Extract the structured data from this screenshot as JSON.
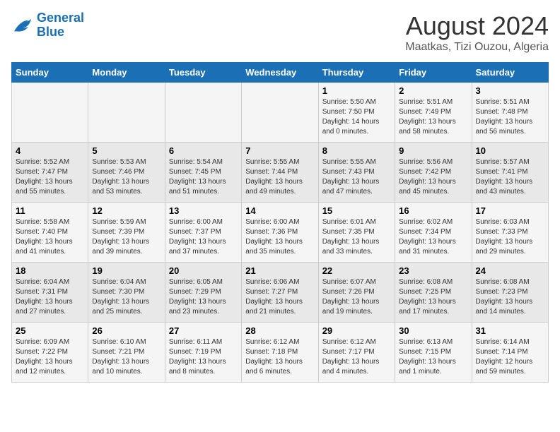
{
  "header": {
    "logo_line1": "General",
    "logo_line2": "Blue",
    "title": "August 2024",
    "subtitle": "Maatkas, Tizi Ouzou, Algeria"
  },
  "calendar": {
    "weekdays": [
      "Sunday",
      "Monday",
      "Tuesday",
      "Wednesday",
      "Thursday",
      "Friday",
      "Saturday"
    ],
    "weeks": [
      [
        {
          "day": "",
          "info": ""
        },
        {
          "day": "",
          "info": ""
        },
        {
          "day": "",
          "info": ""
        },
        {
          "day": "",
          "info": ""
        },
        {
          "day": "1",
          "info": "Sunrise: 5:50 AM\nSunset: 7:50 PM\nDaylight: 14 hours\nand 0 minutes."
        },
        {
          "day": "2",
          "info": "Sunrise: 5:51 AM\nSunset: 7:49 PM\nDaylight: 13 hours\nand 58 minutes."
        },
        {
          "day": "3",
          "info": "Sunrise: 5:51 AM\nSunset: 7:48 PM\nDaylight: 13 hours\nand 56 minutes."
        }
      ],
      [
        {
          "day": "4",
          "info": "Sunrise: 5:52 AM\nSunset: 7:47 PM\nDaylight: 13 hours\nand 55 minutes."
        },
        {
          "day": "5",
          "info": "Sunrise: 5:53 AM\nSunset: 7:46 PM\nDaylight: 13 hours\nand 53 minutes."
        },
        {
          "day": "6",
          "info": "Sunrise: 5:54 AM\nSunset: 7:45 PM\nDaylight: 13 hours\nand 51 minutes."
        },
        {
          "day": "7",
          "info": "Sunrise: 5:55 AM\nSunset: 7:44 PM\nDaylight: 13 hours\nand 49 minutes."
        },
        {
          "day": "8",
          "info": "Sunrise: 5:55 AM\nSunset: 7:43 PM\nDaylight: 13 hours\nand 47 minutes."
        },
        {
          "day": "9",
          "info": "Sunrise: 5:56 AM\nSunset: 7:42 PM\nDaylight: 13 hours\nand 45 minutes."
        },
        {
          "day": "10",
          "info": "Sunrise: 5:57 AM\nSunset: 7:41 PM\nDaylight: 13 hours\nand 43 minutes."
        }
      ],
      [
        {
          "day": "11",
          "info": "Sunrise: 5:58 AM\nSunset: 7:40 PM\nDaylight: 13 hours\nand 41 minutes."
        },
        {
          "day": "12",
          "info": "Sunrise: 5:59 AM\nSunset: 7:39 PM\nDaylight: 13 hours\nand 39 minutes."
        },
        {
          "day": "13",
          "info": "Sunrise: 6:00 AM\nSunset: 7:37 PM\nDaylight: 13 hours\nand 37 minutes."
        },
        {
          "day": "14",
          "info": "Sunrise: 6:00 AM\nSunset: 7:36 PM\nDaylight: 13 hours\nand 35 minutes."
        },
        {
          "day": "15",
          "info": "Sunrise: 6:01 AM\nSunset: 7:35 PM\nDaylight: 13 hours\nand 33 minutes."
        },
        {
          "day": "16",
          "info": "Sunrise: 6:02 AM\nSunset: 7:34 PM\nDaylight: 13 hours\nand 31 minutes."
        },
        {
          "day": "17",
          "info": "Sunrise: 6:03 AM\nSunset: 7:33 PM\nDaylight: 13 hours\nand 29 minutes."
        }
      ],
      [
        {
          "day": "18",
          "info": "Sunrise: 6:04 AM\nSunset: 7:31 PM\nDaylight: 13 hours\nand 27 minutes."
        },
        {
          "day": "19",
          "info": "Sunrise: 6:04 AM\nSunset: 7:30 PM\nDaylight: 13 hours\nand 25 minutes."
        },
        {
          "day": "20",
          "info": "Sunrise: 6:05 AM\nSunset: 7:29 PM\nDaylight: 13 hours\nand 23 minutes."
        },
        {
          "day": "21",
          "info": "Sunrise: 6:06 AM\nSunset: 7:27 PM\nDaylight: 13 hours\nand 21 minutes."
        },
        {
          "day": "22",
          "info": "Sunrise: 6:07 AM\nSunset: 7:26 PM\nDaylight: 13 hours\nand 19 minutes."
        },
        {
          "day": "23",
          "info": "Sunrise: 6:08 AM\nSunset: 7:25 PM\nDaylight: 13 hours\nand 17 minutes."
        },
        {
          "day": "24",
          "info": "Sunrise: 6:08 AM\nSunset: 7:23 PM\nDaylight: 13 hours\nand 14 minutes."
        }
      ],
      [
        {
          "day": "25",
          "info": "Sunrise: 6:09 AM\nSunset: 7:22 PM\nDaylight: 13 hours\nand 12 minutes."
        },
        {
          "day": "26",
          "info": "Sunrise: 6:10 AM\nSunset: 7:21 PM\nDaylight: 13 hours\nand 10 minutes."
        },
        {
          "day": "27",
          "info": "Sunrise: 6:11 AM\nSunset: 7:19 PM\nDaylight: 13 hours\nand 8 minutes."
        },
        {
          "day": "28",
          "info": "Sunrise: 6:12 AM\nSunset: 7:18 PM\nDaylight: 13 hours\nand 6 minutes."
        },
        {
          "day": "29",
          "info": "Sunrise: 6:12 AM\nSunset: 7:17 PM\nDaylight: 13 hours\nand 4 minutes."
        },
        {
          "day": "30",
          "info": "Sunrise: 6:13 AM\nSunset: 7:15 PM\nDaylight: 13 hours\nand 1 minute."
        },
        {
          "day": "31",
          "info": "Sunrise: 6:14 AM\nSunset: 7:14 PM\nDaylight: 12 hours\nand 59 minutes."
        }
      ]
    ]
  }
}
